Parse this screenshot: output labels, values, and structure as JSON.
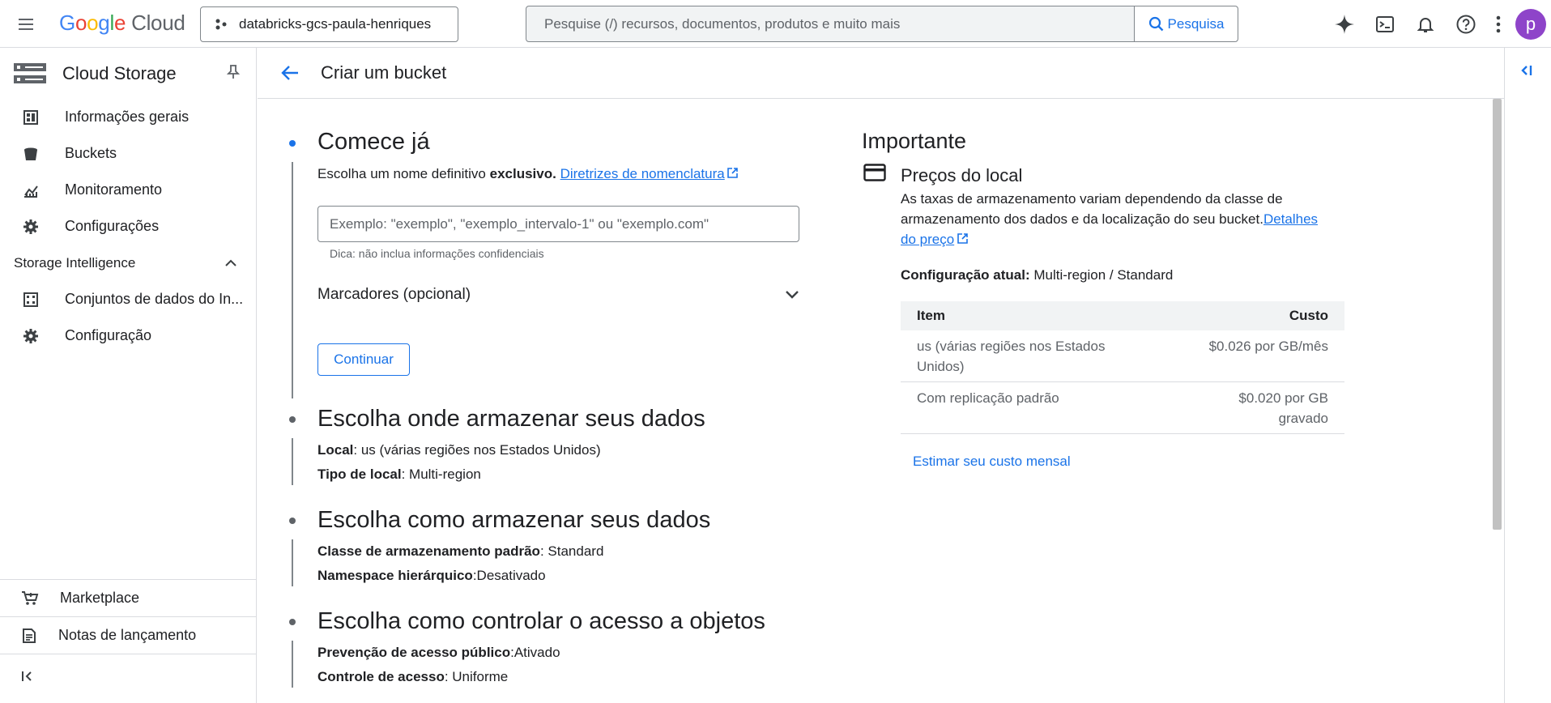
{
  "topbar": {
    "logo": {
      "g1": "G",
      "o1": "o",
      "o2": "o",
      "g2": "g",
      "l": "l",
      "e": "e",
      "cloud": "Cloud"
    },
    "project": "databricks-gcs-paula-henriques",
    "search_placeholder": "Pesquise (/) recursos, documentos, produtos e muito mais",
    "search_button": "Pesquisa",
    "avatar_letter": "p"
  },
  "sidebar": {
    "product_title": "Cloud Storage",
    "items": [
      {
        "label": "Informações gerais",
        "icon": "dashboard-icon"
      },
      {
        "label": "Buckets",
        "icon": "bucket-icon"
      },
      {
        "label": "Monitoramento",
        "icon": "chart-icon"
      },
      {
        "label": "Configurações",
        "icon": "gear-icon"
      }
    ],
    "section": "Storage Intelligence",
    "section_items": [
      {
        "label": "Conjuntos de dados do In...",
        "icon": "dataset-icon"
      },
      {
        "label": "Configuração",
        "icon": "gear-icon"
      }
    ],
    "bottom": [
      {
        "label": "Marketplace",
        "icon": "cart-icon"
      },
      {
        "label": "Notas de lançamento",
        "icon": "notes-icon"
      }
    ]
  },
  "page": {
    "title": "Criar um bucket"
  },
  "step1": {
    "title": "Comece já",
    "desc_prefix": "Escolha um nome definitivo",
    "desc_bold": "exclusivo.",
    "desc_link": "Diretrizes de nomenclatura",
    "input_placeholder": "Exemplo: \"exemplo\", \"exemplo_intervalo-1\" ou \"exemplo.com\"",
    "hint": "Dica: não inclua informações confidenciais",
    "labels_accordion": "Marcadores (opcional)",
    "continue": "Continuar"
  },
  "step2": {
    "title": "Escolha onde armazenar seus dados",
    "line1_label": "Local",
    "line1_value": ": us (várias regiões nos Estados Unidos)",
    "line2_label": "Tipo de local",
    "line2_value": ": Multi-region"
  },
  "step3": {
    "title": "Escolha como armazenar seus dados",
    "line1_label": "Classe de armazenamento padrão",
    "line1_value": ": Standard",
    "line2_label": "Namespace hierárquico",
    "line2_value": ":Desativado"
  },
  "step4": {
    "title": "Escolha como controlar o acesso a objetos",
    "line1_label": "Prevenção de acesso público",
    "line1_value": ":Ativado",
    "line2_label": "Controle de acesso",
    "line2_value": ": Uniforme"
  },
  "important": {
    "title": "Importante",
    "card_title": "Preços do local",
    "desc_line1": "As taxas de armazenamento variam dependendo da classe de",
    "desc_line2": "armazenamento dos dados e da localização do seu bucket.",
    "desc_link1": "Detalhes",
    "desc_link2": "do preço",
    "config_label": "Configuração atual:",
    "config_value": " Multi-region / Standard",
    "table": {
      "headers": [
        "Item",
        "Custo"
      ],
      "rows": [
        {
          "item1": "us (várias regiões nos Estados",
          "item2": "Unidos)",
          "cost1": "$0.026 por GB/mês",
          "cost2": ""
        },
        {
          "item1": "Com replicação padrão",
          "item2": "",
          "cost1": "$0.020 por GB",
          "cost2": "gravado"
        }
      ]
    },
    "estimate_link": "Estimar seu custo mensal"
  }
}
